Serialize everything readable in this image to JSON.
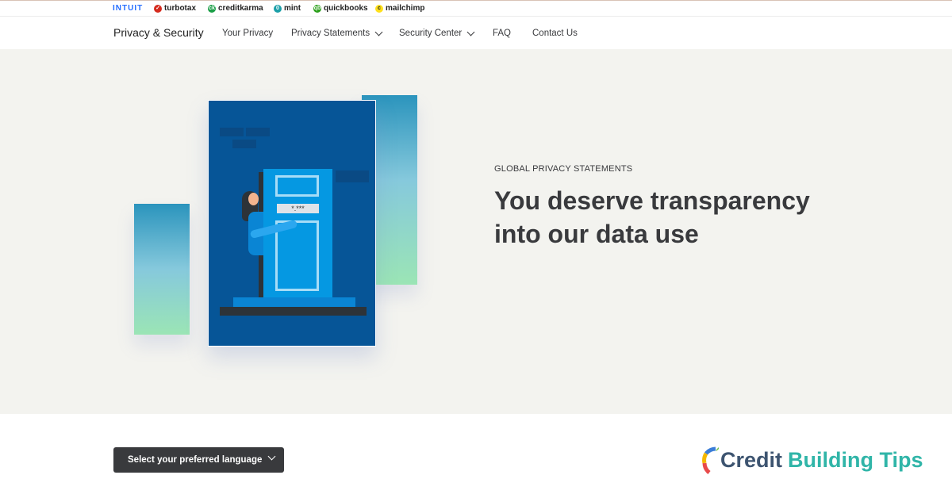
{
  "brand_bar": {
    "brands": [
      {
        "name": "INTUIT",
        "icon": "intuit-logo"
      },
      {
        "name": "turbotax",
        "icon": "turbotax-check-icon",
        "color": "#d52b1e"
      },
      {
        "name": "creditkarma",
        "icon": "creditkarma-icon",
        "color": "#1a9e46"
      },
      {
        "name": "mint",
        "icon": "mint-icon",
        "color": "#1c9fa8"
      },
      {
        "name": "quickbooks",
        "icon": "quickbooks-icon",
        "color": "#2ca01c"
      },
      {
        "name": "mailchimp",
        "icon": "mailchimp-icon",
        "color": "#ffe01b"
      }
    ]
  },
  "nav": {
    "title": "Privacy & Security",
    "items": [
      {
        "label": "Your Privacy",
        "dropdown": false
      },
      {
        "label": "Privacy Statements",
        "dropdown": true
      },
      {
        "label": "Security Center",
        "dropdown": true
      },
      {
        "label": "FAQ",
        "dropdown": false
      },
      {
        "label": "Contact Us",
        "dropdown": false
      }
    ]
  },
  "hero": {
    "eyebrow": "GLOBAL PRIVACY STATEMENTS",
    "headline": "You deserve transparency into our data use",
    "illustration": {
      "keypad_text": "*.***"
    }
  },
  "language_select": {
    "label": "Select your preferred language"
  },
  "watermark": {
    "word1": "Credit",
    "word2": "Building Tips"
  }
}
